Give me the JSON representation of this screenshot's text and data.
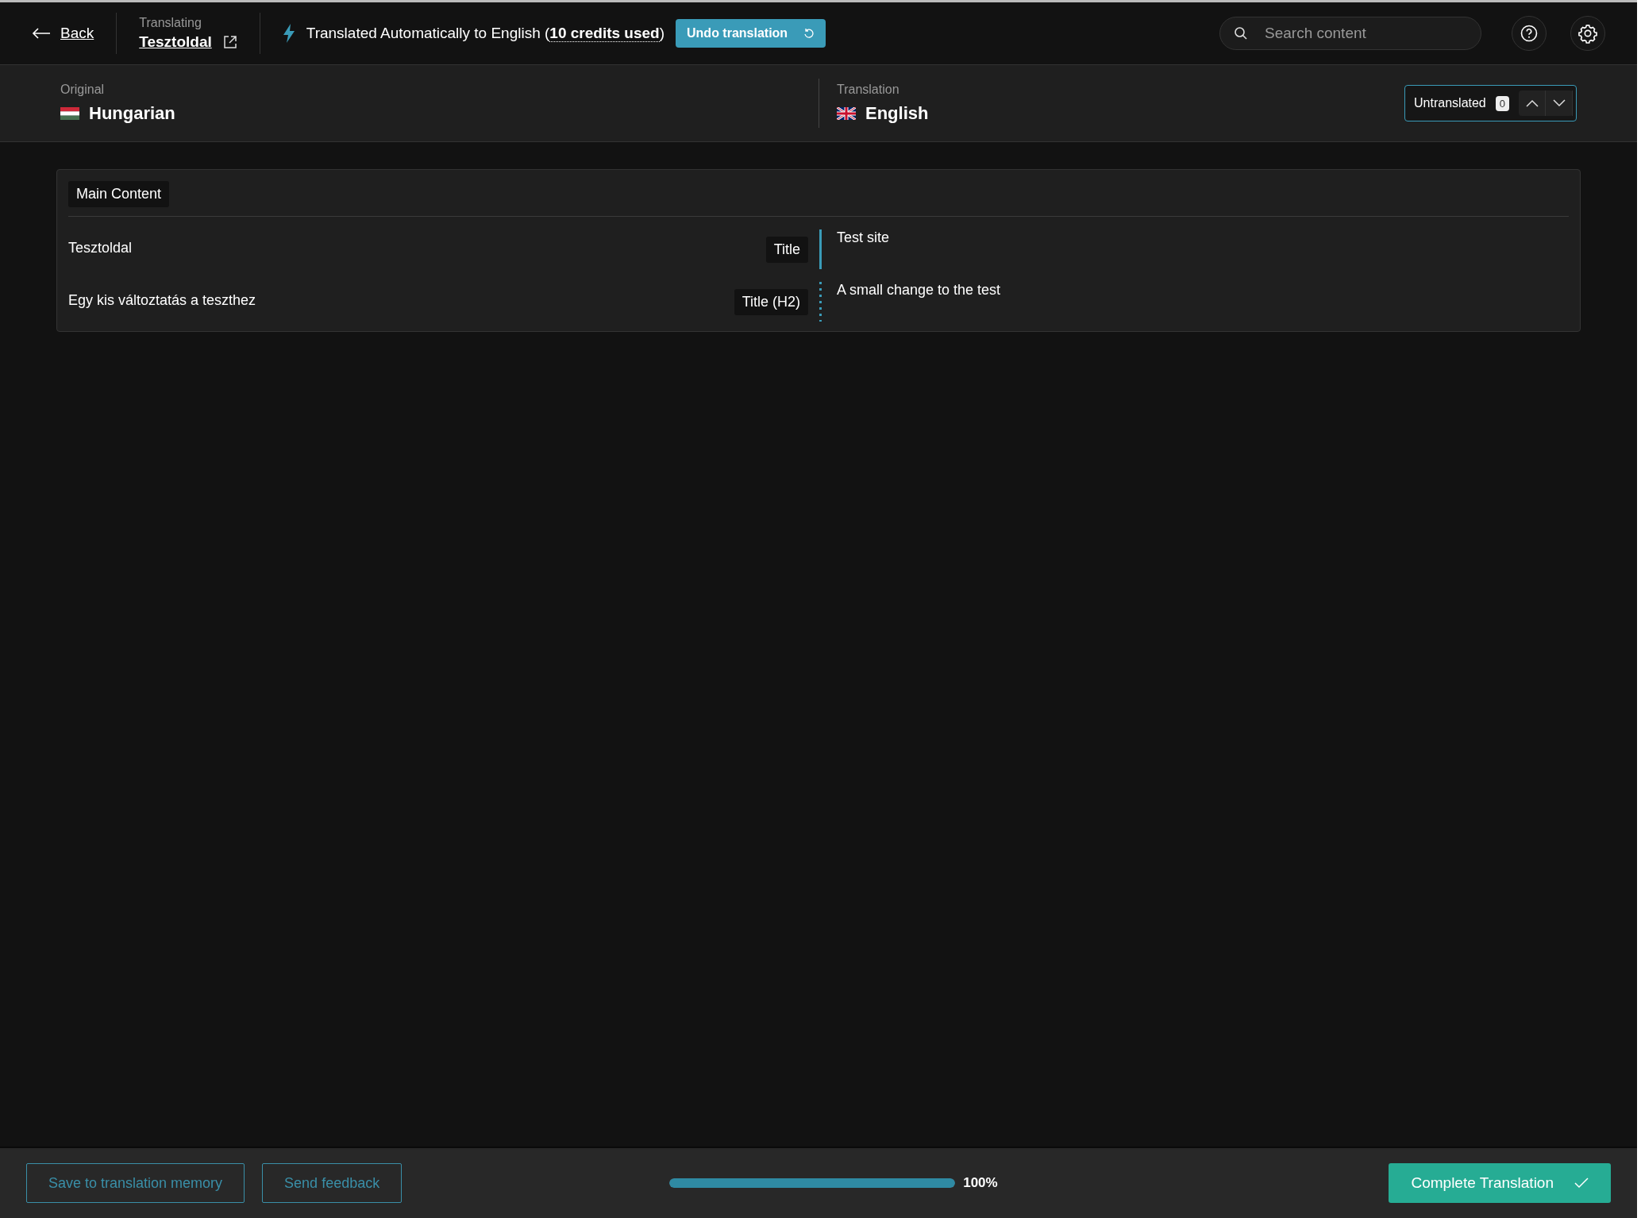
{
  "top_bar": {
    "back": "Back",
    "context_label": "Translating",
    "page_link": "Tesztoldal",
    "notice": "Translated Automatically to English (**10 credits used**)",
    "undo_button": "Undo translation",
    "search": {
      "placeholder": "Search content"
    }
  },
  "languages": {
    "original": {
      "label": "Original",
      "name": "Hungarian"
    },
    "translation": {
      "label": "Translation",
      "name": "English"
    },
    "filter": {
      "label": "Untranslated",
      "count": "0"
    }
  },
  "section": {
    "title": "Main Content",
    "rows": [
      {
        "original": "Tesztoldal",
        "type": "Title",
        "translation": "Test site",
        "selected": true
      },
      {
        "original": "Egy kis változtatás a teszthez",
        "type": "Title (H2)",
        "translation": "A small change to the test",
        "selected": false
      }
    ]
  },
  "footer": {
    "buttons": [
      "Save to translation memory",
      "Send feedback"
    ],
    "progress": {
      "level": 1.0,
      "reading": "100%"
    },
    "complete_button": "Complete Translation"
  }
}
